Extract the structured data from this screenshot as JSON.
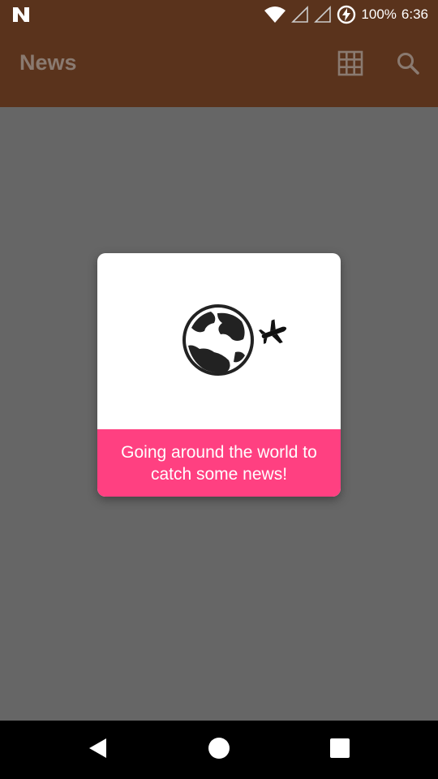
{
  "status_bar": {
    "battery_percent": "100%",
    "time": "6:36"
  },
  "app_bar": {
    "title": "News",
    "grid_icon": "grid-view-icon",
    "search_icon": "search-icon"
  },
  "dialog": {
    "illustration_icons": [
      "globe-icon",
      "airplane-icon"
    ],
    "message": "Going around the world to catch some news!",
    "message_bar_color": "#ff4081"
  },
  "nav_bar": {
    "icons": [
      "back-icon",
      "home-icon",
      "recents-icon"
    ]
  },
  "colors": {
    "app_bar": "#5a331c",
    "scrim": "#666666",
    "accent": "#ff4081"
  }
}
